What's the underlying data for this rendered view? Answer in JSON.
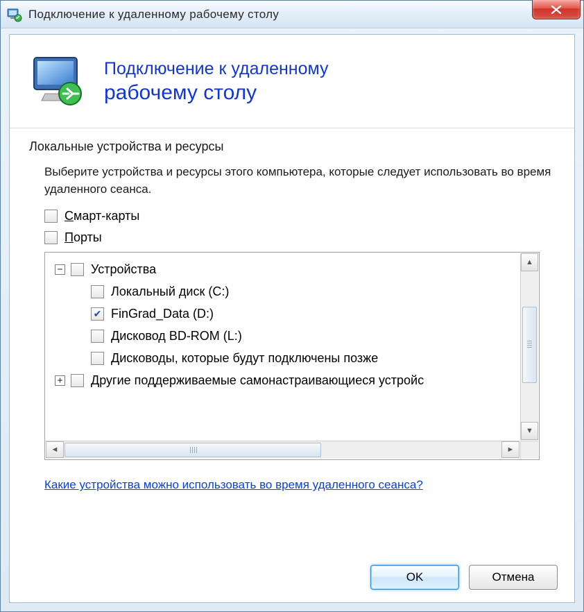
{
  "window": {
    "title": "Подключение к удаленному рабочему столу"
  },
  "header": {
    "line1": "Подключение к удаленному",
    "line2": "рабочему столу"
  },
  "section": {
    "title": "Локальные устройства и ресурсы",
    "description": "Выберите устройства и ресурсы этого компьютера, которые следует использовать во время удаленного сеанса."
  },
  "checks": {
    "smart_cards": {
      "label": "Смарт-карты",
      "checked": false
    },
    "ports": {
      "label": "Порты",
      "checked": false
    }
  },
  "tree": {
    "devices": {
      "label": "Устройства",
      "expanded": true,
      "checked": false,
      "children": [
        {
          "label": "Локальный диск (C:)",
          "checked": false
        },
        {
          "label": "FinGrad_Data (D:)",
          "checked": true
        },
        {
          "label": "Дисковод BD-ROM (L:)",
          "checked": false
        },
        {
          "label": "Дисководы, которые будут подключены позже",
          "checked": false
        }
      ]
    },
    "other": {
      "label": "Другие поддерживаемые самонастраивающиеся устройс",
      "expanded": false,
      "checked": false
    }
  },
  "help_link": "Какие устройства можно использовать во время удаленного сеанса?",
  "buttons": {
    "ok": "OK",
    "cancel": "Отмена"
  },
  "glyphs": {
    "checkmark": "✔",
    "minus": "−",
    "plus": "+"
  }
}
